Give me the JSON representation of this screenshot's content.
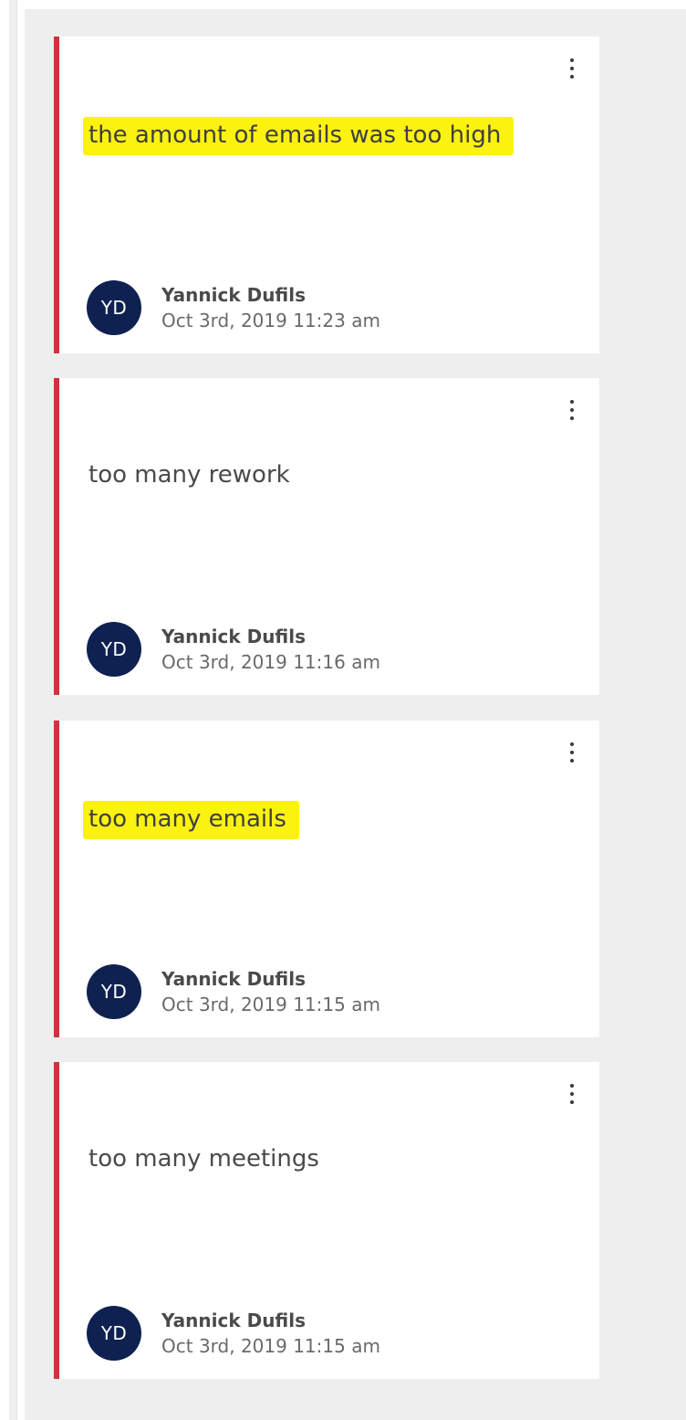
{
  "cards": [
    {
      "text": "the amount of emails was too high",
      "highlighted": true,
      "author_initials": "YD",
      "author_name": "Yannick Dufils",
      "date": "Oct 3rd, 2019 11:23 am"
    },
    {
      "text": "too many rework",
      "highlighted": false,
      "author_initials": "YD",
      "author_name": "Yannick Dufils",
      "date": "Oct 3rd, 2019 11:16 am"
    },
    {
      "text": "too many emails",
      "highlighted": true,
      "author_initials": "YD",
      "author_name": "Yannick Dufils",
      "date": "Oct 3rd, 2019 11:15 am"
    },
    {
      "text": "too many meetings",
      "highlighted": false,
      "author_initials": "YD",
      "author_name": "Yannick Dufils",
      "date": "Oct 3rd, 2019 11:15 am"
    }
  ],
  "colors": {
    "card_accent": "#d0323f",
    "avatar_bg": "#0e2150",
    "highlight": "#fbf20f",
    "column_bg": "#eeeeee"
  },
  "icons": {
    "card_menu": "more-vertical-icon"
  }
}
